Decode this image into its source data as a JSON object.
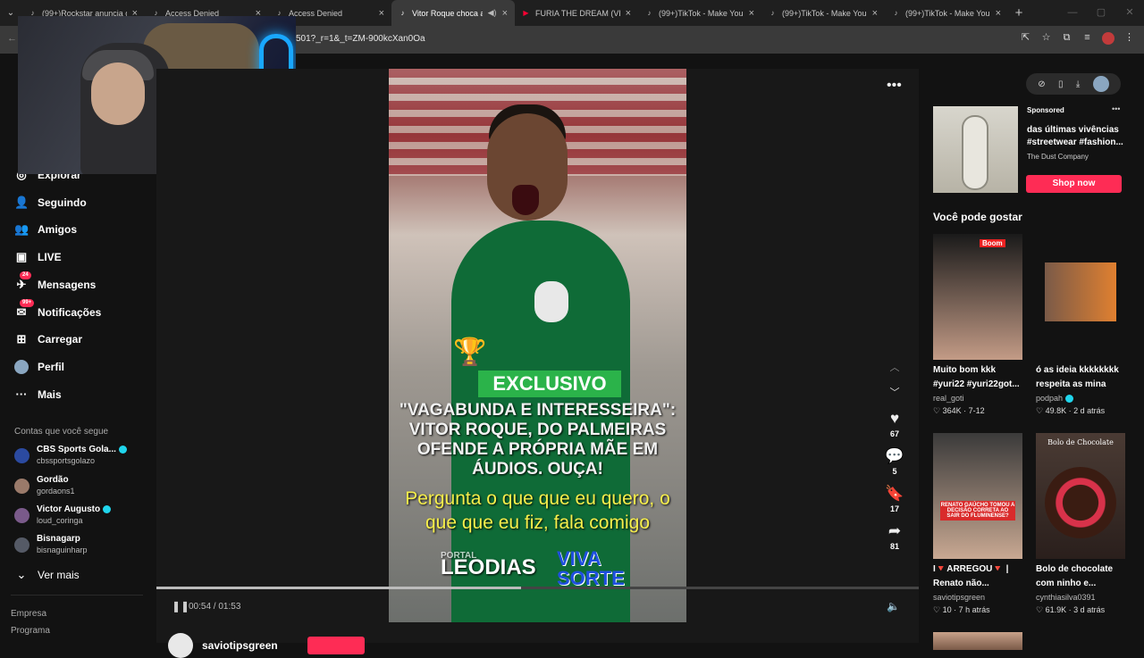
{
  "browser": {
    "tabs": [
      {
        "title": "(99+)Rockstar anuncia o",
        "favicon": "tiktok-icon"
      },
      {
        "title": "Access Denied",
        "favicon": "tiktok-icon"
      },
      {
        "title": "Access Denied",
        "favicon": "tiktok-icon"
      },
      {
        "title": "Vitor Roque choca ao",
        "favicon": "tiktok-icon"
      },
      {
        "title": "FURIA THE DREAM (VLOG",
        "favicon": "youtube-icon"
      },
      {
        "title": "(99+)TikTok - Make Your",
        "favicon": "tiktok-icon"
      },
      {
        "title": "(99+)TikTok - Make Your",
        "favicon": "tiktok-icon"
      },
      {
        "title": "(99+)TikTok - Make Your",
        "favicon": "tiktok-icon"
      }
    ],
    "active_tab": 3,
    "url": "501?_r=1&_t=ZM-900kcXan0Oa"
  },
  "sidebar": {
    "nav": [
      {
        "label": "Explorar",
        "icon": "compass-icon"
      },
      {
        "label": "Seguindo",
        "icon": "following-icon"
      },
      {
        "label": "Amigos",
        "icon": "friends-icon"
      },
      {
        "label": "LIVE",
        "icon": "live-icon"
      },
      {
        "label": "Mensagens",
        "icon": "messages-icon",
        "badge": "24"
      },
      {
        "label": "Notificações",
        "icon": "notifications-icon",
        "badge": "99+"
      },
      {
        "label": "Carregar",
        "icon": "upload-icon"
      },
      {
        "label": "Perfil",
        "icon": "profile-icon"
      },
      {
        "label": "Mais",
        "icon": "more-icon"
      }
    ],
    "following_title": "Contas que você segue",
    "following": [
      {
        "name": "CBS Sports Gola...",
        "handle": "cbssportsgolazo",
        "verified": true,
        "color": "#2b4aa0"
      },
      {
        "name": "Gordão",
        "handle": "gordaons1",
        "verified": false,
        "color": "#9a7a6a"
      },
      {
        "name": "Victor Augusto",
        "handle": "loud_coringa",
        "verified": true,
        "color": "#7a5a8a"
      },
      {
        "name": "Bisnagarp",
        "handle": "bisnaguinharp",
        "verified": false,
        "color": "#555a66"
      }
    ],
    "see_more": "Ver mais",
    "footer": [
      "Empresa",
      "Programa"
    ]
  },
  "video": {
    "badge": "EXCLUSIVO",
    "headline": "\"VAGABUNDA E INTERESSEIRA\": VITOR ROQUE, DO PALMEIRAS OFENDE A PRÓPRIA MÃE EM ÁUDIOS. OUÇA!",
    "caption": "Pergunta o que que eu quero, o que que eu fiz, fala comigo",
    "watermark_small": "PORTAL",
    "watermark_left": "LEODIAS",
    "watermark_right_1": "VIVA",
    "watermark_right_2": "SORTE",
    "likes": "67",
    "comments": "5",
    "saves": "17",
    "shares": "81",
    "time": "00:54 / 01:53",
    "progress": 0.478,
    "author": "saviotipsgreen"
  },
  "ad": {
    "sponsored": "Sponsored",
    "title": "das últimas vivências #streetwear #fashion...",
    "company": "The Dust Company",
    "cta": "Shop now"
  },
  "recommendations_title": "Você pode gostar",
  "cards": [
    {
      "title": "Muito bom kkk #yuri22 #yuri22got...",
      "author": "real_goti",
      "likes": "364K",
      "date": "7-12",
      "verified": false
    },
    {
      "title": "ó as ideia kkkkkkkk respeita as mina po...",
      "author": "podpah",
      "likes": "49.8K",
      "date": "2 d atrás",
      "verified": true
    },
    {
      "title": "I🔻ARREGOU🔻 | Renato não...",
      "author": "saviotipsgreen",
      "likes": "10",
      "date": "7 h atrás",
      "verified": false
    },
    {
      "title": "Bolo de chocolate com ninho e...",
      "author": "cynthiasilva0391",
      "likes": "61.9K",
      "date": "3 d atrás",
      "verified": false
    }
  ],
  "thumbs": {
    "card1_label": "Boom",
    "card3_band": "RENATO GAÚCHO TOMOU A DECISÃO CORRETA AO SAIR DO FLUMINENSE?",
    "card4_title": "Bolo de Chocolate"
  },
  "colors": {
    "accent": "#fe2c55",
    "verified": "#20d5ec",
    "badge_green": "#2bb34a",
    "caption_yellow": "#f7ef4b"
  }
}
